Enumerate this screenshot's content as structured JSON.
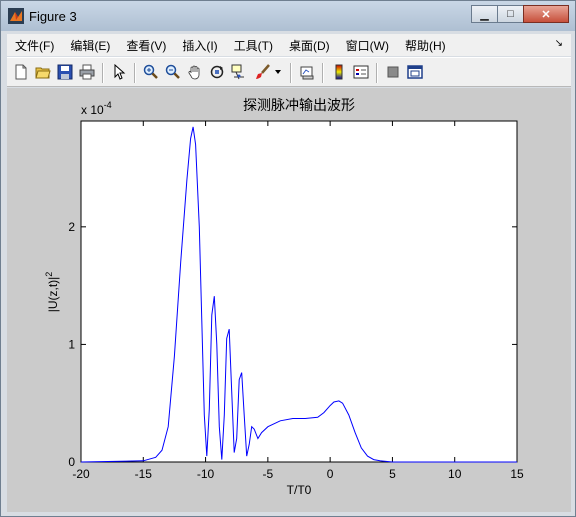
{
  "window": {
    "title": "Figure 3",
    "min_label": "▁",
    "max_label": "□",
    "close_label": "✕"
  },
  "menu": {
    "items": [
      "文件(F)",
      "编辑(E)",
      "查看(V)",
      "插入(I)",
      "工具(T)",
      "桌面(D)",
      "窗口(W)",
      "帮助(H)"
    ],
    "overflow": "↘"
  },
  "toolbar": {
    "icons": [
      "new-figure-icon",
      "open-file-icon",
      "save-icon",
      "print-icon",
      "edit-plot-arrow-icon",
      "zoom-in-icon",
      "zoom-out-icon",
      "pan-hand-icon",
      "rotate-3d-icon",
      "data-cursor-icon",
      "brush-icon",
      "brush-dropdown-icon",
      "link-plot-icon",
      "colorbar-icon",
      "legend-icon",
      "hide-plot-tools-icon",
      "show-plot-tools-icon"
    ]
  },
  "chart_data": {
    "type": "line",
    "title": "探测脉冲输出波形",
    "xlabel": "T/T0",
    "ylabel": "|U(z,t)|²",
    "ylabel_main": "|U(z,t)|",
    "ylabel_sup": "2",
    "exponent_label": "x 10",
    "exponent_sup": "-4",
    "xlim": [
      -20,
      15
    ],
    "ylim": [
      0,
      2.9
    ],
    "xticks": [
      -20,
      -15,
      -10,
      -5,
      0,
      5,
      10,
      15
    ],
    "xtick_labels": [
      "-20",
      "-15",
      "-10",
      "-5",
      "0",
      "5",
      "10",
      "15"
    ],
    "yticks": [
      0,
      1,
      2
    ],
    "ytick_labels": [
      "0",
      "1",
      "2"
    ],
    "grid": false,
    "series_color": "#0000ff",
    "x": [
      -20,
      -15,
      -14,
      -13.5,
      -13,
      -12.5,
      -12,
      -11.5,
      -11.2,
      -11,
      -10.8,
      -10.5,
      -10.3,
      -10.1,
      -9.9,
      -9.7,
      -9.5,
      -9.3,
      -9.1,
      -8.9,
      -8.7,
      -8.5,
      -8.3,
      -8.1,
      -7.9,
      -7.7,
      -7.5,
      -7.3,
      -7.1,
      -6.9,
      -6.7,
      -6.5,
      -6.3,
      -6.1,
      -5.8,
      -5.5,
      -5,
      -4,
      -3,
      -2,
      -1,
      -0.5,
      0,
      0.3,
      0.7,
      1,
      1.5,
      2,
      2.5,
      3,
      3.5,
      4,
      5,
      8,
      15
    ],
    "y": [
      0,
      0.01,
      0.04,
      0.1,
      0.3,
      0.9,
      1.7,
      2.4,
      2.75,
      2.85,
      2.7,
      2.0,
      1.2,
      0.4,
      0.05,
      0.45,
      1.25,
      1.41,
      1.0,
      0.3,
      0.02,
      0.4,
      1.05,
      1.13,
      0.6,
      0.08,
      0.2,
      0.7,
      0.76,
      0.4,
      0.05,
      0.15,
      0.3,
      0.28,
      0.2,
      0.25,
      0.3,
      0.35,
      0.37,
      0.37,
      0.38,
      0.42,
      0.48,
      0.51,
      0.52,
      0.5,
      0.4,
      0.25,
      0.12,
      0.05,
      0.02,
      0.01,
      0,
      0,
      0
    ]
  }
}
